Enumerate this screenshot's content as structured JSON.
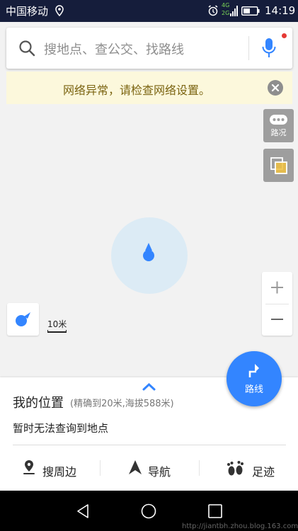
{
  "status_bar": {
    "carrier": "中国移动",
    "network_top": "4G",
    "network_bottom": "2G",
    "time": "14:19",
    "icons": [
      "location-icon",
      "alarm-icon",
      "signal-icon",
      "battery-icon"
    ]
  },
  "search": {
    "placeholder": "搜地点、查公交、找路线",
    "icons": [
      "search-icon",
      "mic-icon"
    ]
  },
  "warning": {
    "text": "网络异常，请检查网络设置。"
  },
  "map_controls": {
    "traffic_label": "路况",
    "scale_label": "10米",
    "zoom_in": "+",
    "zoom_out": "−"
  },
  "route_button": {
    "label": "路线"
  },
  "bottom_sheet": {
    "title": "我的位置",
    "detail": "(精确到20米,海拔588米)",
    "subtitle": "暂时无法查询到地点",
    "actions": [
      {
        "label": "搜周边",
        "icon": "pin-icon"
      },
      {
        "label": "导航",
        "icon": "navigation-arrow-icon"
      },
      {
        "label": "足迹",
        "icon": "footprint-icon"
      }
    ]
  },
  "watermark": "http://jiantbh.zhou.blog.163.com",
  "colors": {
    "accent": "#3385ff",
    "status_bar": "#151d3b",
    "warning_bg": "#fcf8dc",
    "warning_text": "#7b6411"
  }
}
